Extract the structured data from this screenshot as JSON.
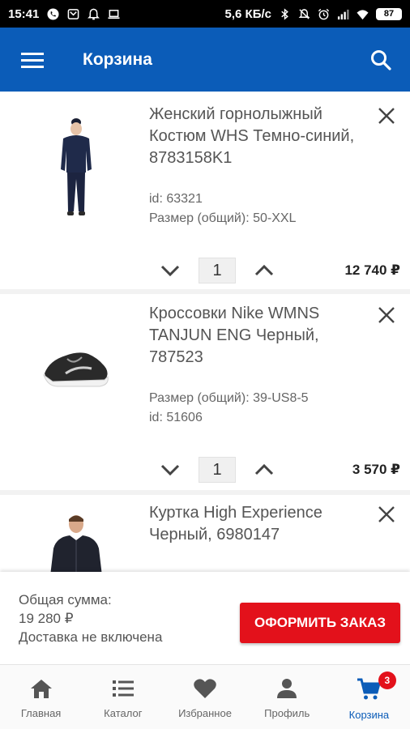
{
  "status_bar": {
    "time": "15:41",
    "network_speed": "5,6 КБ/с",
    "battery": "87",
    "icons": [
      "phone-icon",
      "mail-icon",
      "bell-icon",
      "laptop-icon",
      "bluetooth-icon",
      "mute-icon",
      "alarm-icon",
      "signal-icon",
      "wifi-icon",
      "battery-icon"
    ]
  },
  "app_bar": {
    "title": "Корзина",
    "menu_icon": "hamburger-menu-icon",
    "search_icon": "search-icon",
    "color": "#0b5cb8"
  },
  "cart": {
    "items": [
      {
        "name": "Женский горнолыжный Костюм WHS Темно-синий, 8783158K1",
        "meta1": "id: 63321",
        "meta2": "Размер (общий): 50-XXL",
        "quantity": "1",
        "price": "12 740 ₽"
      },
      {
        "name": "Кроссовки Nike WMNS TANJUN ENG Черный, 787523",
        "meta1": "Размер (общий): 39-US8-5",
        "meta2": "id: 51606",
        "quantity": "1",
        "price": "3 570 ₽"
      },
      {
        "name": "Куртка High Experience Черный, 6980147",
        "meta1": "",
        "meta2": "",
        "quantity": "",
        "price": ""
      }
    ]
  },
  "summary": {
    "total_label": "Общая сумма:",
    "total_value": "19 280 ₽",
    "delivery_note": "Доставка не включена",
    "checkout_label": "ОФОРМИТЬ ЗАКАЗ",
    "checkout_color": "#e3111b"
  },
  "bottom_nav": {
    "items": [
      {
        "label": "Главная",
        "icon": "home-icon"
      },
      {
        "label": "Каталог",
        "icon": "catalog-list-icon"
      },
      {
        "label": "Избранное",
        "icon": "heart-icon"
      },
      {
        "label": "Профиль",
        "icon": "person-icon"
      },
      {
        "label": "Корзина",
        "icon": "cart-icon",
        "badge": "3",
        "active": true
      }
    ],
    "active_color": "#0b5cb8"
  }
}
